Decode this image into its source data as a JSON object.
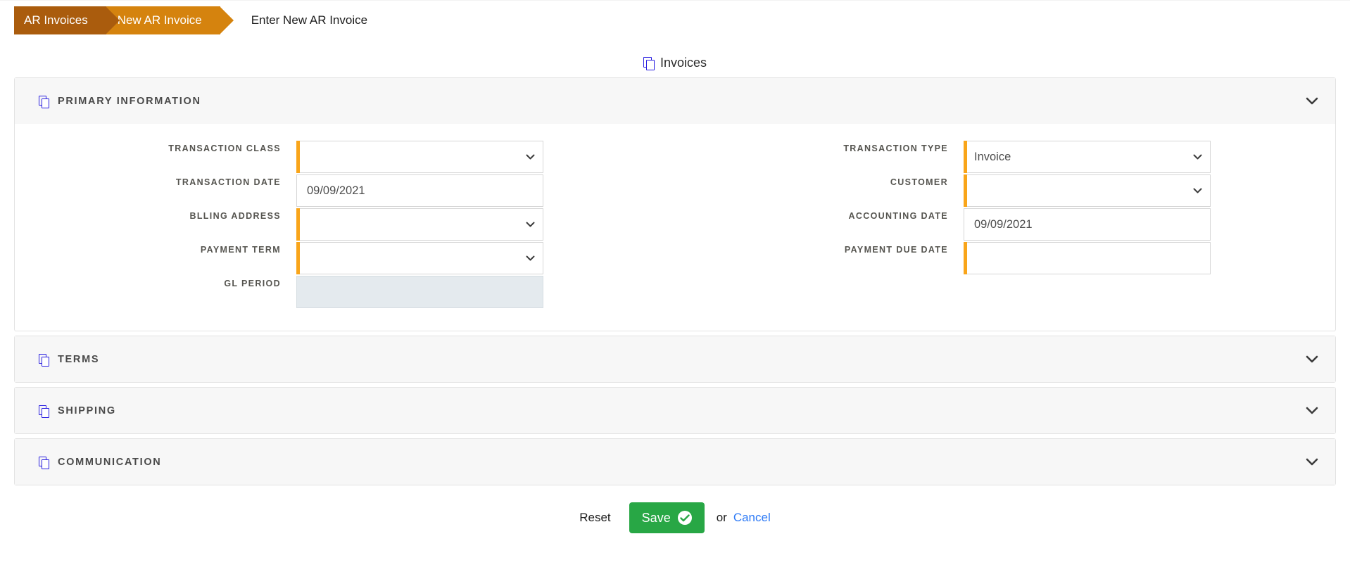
{
  "breadcrumb": {
    "items": [
      {
        "label": "AR Invoices",
        "color": "#aa5c0d"
      },
      {
        "label": "New AR Invoice",
        "color": "#d5830e"
      }
    ],
    "current": "Enter New AR Invoice"
  },
  "page": {
    "title": "Invoices",
    "title_icon": "copy-icon"
  },
  "sections": [
    {
      "id": "primary-information",
      "title": "PRIMARY INFORMATION",
      "icon": "copy-icon",
      "expanded": true,
      "chevron": "chevron-down-icon"
    },
    {
      "id": "terms",
      "title": "TERMS",
      "icon": "copy-icon",
      "expanded": false,
      "chevron": "chevron-down-icon"
    },
    {
      "id": "shipping",
      "title": "SHIPPING",
      "icon": "copy-icon",
      "expanded": false,
      "chevron": "chevron-down-icon"
    },
    {
      "id": "communication",
      "title": "COMMUNICATION",
      "icon": "copy-icon",
      "expanded": false,
      "chevron": "chevron-down-icon"
    }
  ],
  "primary_information": {
    "left_fields": [
      {
        "label": "TRANSACTION CLASS",
        "value": "",
        "control": "select",
        "required": true,
        "disabled": false
      },
      {
        "label": "TRANSACTION DATE",
        "value": "09/09/2021",
        "control": "text",
        "required": false,
        "disabled": false
      },
      {
        "label": "BLLING ADDRESS",
        "value": "",
        "control": "select",
        "required": true,
        "disabled": false
      },
      {
        "label": "PAYMENT TERM",
        "value": "",
        "control": "select",
        "required": true,
        "disabled": false
      },
      {
        "label": "GL PERIOD",
        "value": "",
        "control": "text",
        "required": false,
        "disabled": true
      }
    ],
    "right_fields": [
      {
        "label": "TRANSACTION TYPE",
        "value": "Invoice",
        "control": "select",
        "required": true,
        "disabled": false
      },
      {
        "label": "CUSTOMER",
        "value": "",
        "control": "select",
        "required": true,
        "disabled": false
      },
      {
        "label": "ACCOUNTING DATE",
        "value": "09/09/2021",
        "control": "text",
        "required": false,
        "disabled": false
      },
      {
        "label": "PAYMENT DUE DATE",
        "value": "",
        "control": "text",
        "required": true,
        "disabled": false
      }
    ]
  },
  "actions": {
    "reset_label": "Reset",
    "save_label": "Save",
    "save_icon": "check-circle-icon",
    "or_label": "or",
    "cancel_label": "Cancel"
  },
  "colors": {
    "breadcrumb_past": "#aa5c0d",
    "breadcrumb_active": "#d5830e",
    "required_marker": "#f9a51a",
    "save_green": "#28a745",
    "link_blue": "#2f7bf6",
    "icon_blue": "#2a1fe0",
    "panel_header_bg": "#f7f7f7",
    "disabled_field_bg": "#e4eaee"
  }
}
